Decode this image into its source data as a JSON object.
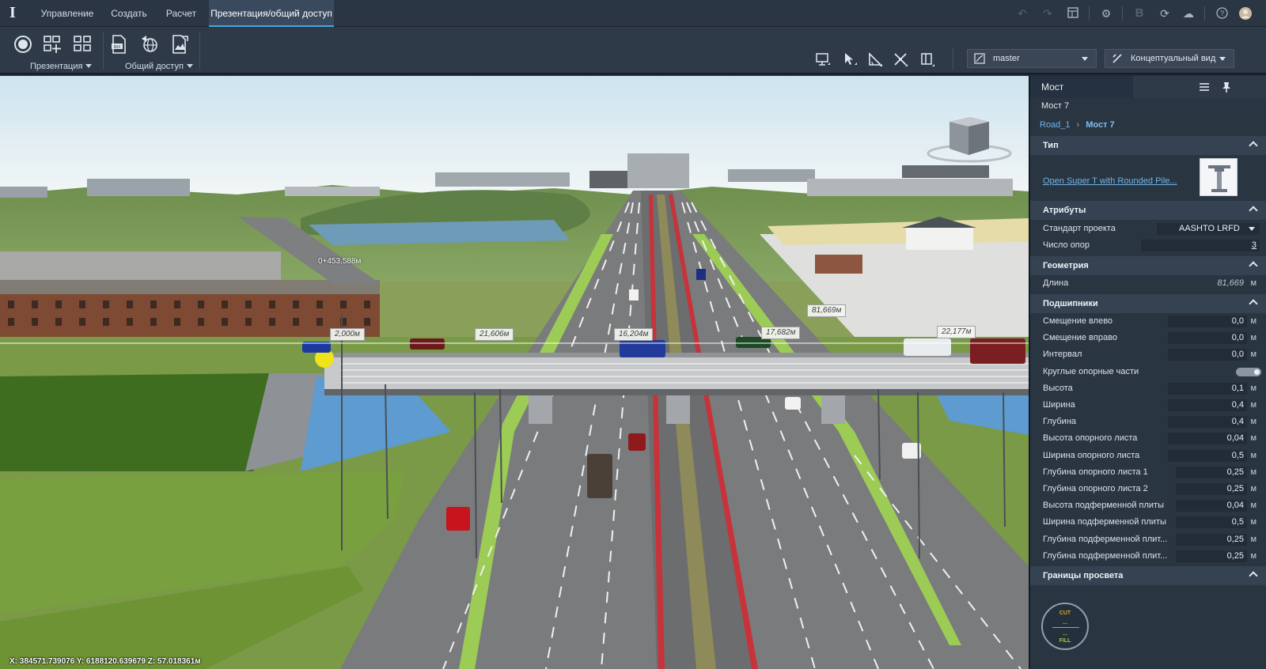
{
  "menu": {
    "logo": "I",
    "tabs": [
      "Управление",
      "Создать",
      "Расчет",
      "Презентация/общий доступ"
    ],
    "active_tab": "Презентация/общий доступ",
    "right_icons": [
      "undo-icon",
      "redo-icon",
      "layout-icon",
      "settings-icon",
      "bold-b-icon",
      "refresh-icon",
      "cloud-icon",
      "help-icon",
      "user-avatar-icon"
    ]
  },
  "ribbon": {
    "groups": [
      {
        "label": "Презентация",
        "buttons": [
          "record-icon",
          "add-grid-icon",
          "grid-icon"
        ]
      },
      {
        "label": "Общий доступ",
        "buttons": [
          "export-file-icon",
          "publish-globe-icon",
          "export-image-icon"
        ]
      }
    ],
    "tools": [
      "monitor-icon",
      "select-arrow-icon",
      "measure-angle-icon",
      "crosshair-icon",
      "panel-icon"
    ],
    "proposal_dropdown": {
      "value": "master",
      "icon": "proposal-icon"
    },
    "style_dropdown": {
      "value": "Концептуальный вид",
      "icon": "visual-style-icon"
    }
  },
  "viewport": {
    "station_label": "0+453,588м",
    "dimension_labels": [
      "2,000м",
      "21,606м",
      "16,204м",
      "17,682м",
      "81,669м",
      "22,177м"
    ],
    "coordinates": "X: 384571.739076  Y: 6188120.639679  Z: 57.018361м"
  },
  "panel": {
    "tab": "Мост",
    "object_name": "Мост 7",
    "breadcrumb": {
      "parent": "Road_1",
      "separator": "›",
      "current": "Мост 7"
    },
    "sections": {
      "type": {
        "title": "Тип",
        "link": "Open Super T with Rounded Pile..."
      },
      "attributes": {
        "title": "Атрибуты",
        "rows": [
          {
            "label": "Стандарт проекта",
            "value": "AASHTO LRFD"
          },
          {
            "label": "Число опор",
            "value": "3"
          }
        ]
      },
      "geometry": {
        "title": "Геометрия",
        "rows": [
          {
            "label": "Длина",
            "value": "81,669",
            "unit": "м"
          }
        ]
      },
      "bearings": {
        "title": "Подшипники",
        "rows": [
          {
            "label": "Смещение влево",
            "value": "0,0",
            "unit": "м"
          },
          {
            "label": "Смещение вправо",
            "value": "0,0",
            "unit": "м"
          },
          {
            "label": "Интервал",
            "value": "0,0",
            "unit": "м"
          },
          {
            "label": "Круглые опорные части",
            "toggle": true
          },
          {
            "label": "Высота",
            "value": "0,1",
            "unit": "м"
          },
          {
            "label": "Ширина",
            "value": "0,4",
            "unit": "м"
          },
          {
            "label": "Глубина",
            "value": "0,4",
            "unit": "м"
          },
          {
            "label": "Высота опорного листа",
            "value": "0,04",
            "unit": "м"
          },
          {
            "label": "Ширина опорного листа",
            "value": "0,5",
            "unit": "м"
          },
          {
            "label": "Глубина опорного листа 1",
            "value": "0,25",
            "unit": "м"
          },
          {
            "label": "Глубина опорного листа 2",
            "value": "0,25",
            "unit": "м"
          },
          {
            "label": "Высота подферменной плиты",
            "value": "0,04",
            "unit": "м"
          },
          {
            "label": "Ширина подферменной плиты",
            "value": "0,5",
            "unit": "м"
          },
          {
            "label": "Глубина подферменной плит...",
            "value": "0,25",
            "unit": "м"
          },
          {
            "label": "Глубина подферменной плит...",
            "value": "0,25",
            "unit": "м"
          }
        ]
      },
      "clearance": {
        "title": "Границы просвета"
      }
    },
    "compass": {
      "cut": "CUT",
      "fill": "FILL",
      "cut_value": "--",
      "fill_value": "--"
    }
  }
}
